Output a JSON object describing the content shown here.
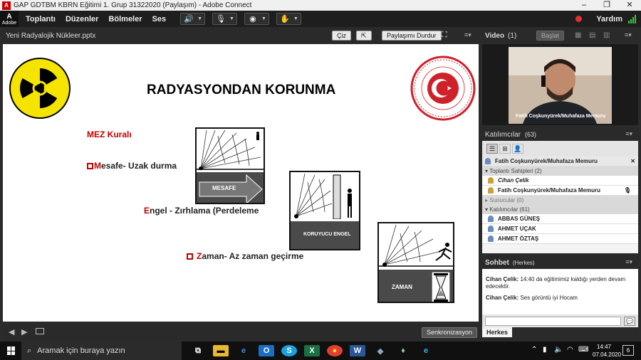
{
  "window": {
    "title": "GAP GDTBM KBRN Eğitimi 1. Grup 31322020 (Paylaşım) - Adobe Connect"
  },
  "menu": {
    "adobe_label": "Adobe",
    "items": [
      "Toplantı",
      "Düzenler",
      "Bölmeler",
      "Ses"
    ],
    "help": "Yardım"
  },
  "share": {
    "file_name": "Yeni Radyalojik Nükleer.pptx",
    "draw_label": "Çiz",
    "stop_label": "Paylaşımı Durdur",
    "sync_label": "Senkronizasyon"
  },
  "slide": {
    "title": "RADYASYONDAN KORUNMA",
    "rule_heading": "MEZ Kuralı",
    "item1_initial": "M",
    "item1_rest": "esafe- Uzak durma",
    "item2_initial": "E",
    "item2_rest": "ngel - Zırhlama (Perdeleme",
    "item3_initial": "Z",
    "item3_rest": "aman- Az zaman geçirme",
    "fig1_label": "MESAFE",
    "fig2_label": "KORUYUCU ENGEL",
    "fig3_label": "ZAMAN",
    "seal_text": "TÜRKİYE CUMHURİYETİ TİCARET BAKANLIĞI"
  },
  "video": {
    "title": "Video",
    "count": "(1)",
    "start_label": "Başlat",
    "caption": "Fatih Coşkunyürek/Muhafaza Memuru"
  },
  "participants": {
    "title": "Katılımcılar",
    "count": "(63)",
    "selected": "Fatih Coşkunyürek/Muhafaza Memuru",
    "hosts_header": "Toplantı Sahipleri (2)",
    "hosts": [
      "Cihan Çelik",
      "Fatih Coşkunyürek/Muhafaza Memuru"
    ],
    "presenters_header": "Sunucular (0)",
    "attendees_header": "Katılımcılar (61)",
    "attendees": [
      "ABBAS GÜNEŞ",
      "AHMET UÇAK",
      "AHMET ÖZTAŞ"
    ]
  },
  "chat": {
    "title": "Sohbet",
    "scope": "(Herkes)",
    "messages": [
      {
        "sender": "Cihan Çelik:",
        "text": "14:40 da eğitimimiz kaldığı yerden devam edecektir."
      },
      {
        "sender": "Cihan Çelik:",
        "text": "Ses görüntü iyi Hocam"
      }
    ],
    "tab": "Herkes"
  },
  "taskbar": {
    "search_placeholder": "Aramak için buraya yazın",
    "time": "14:47",
    "date": "07.04.2020",
    "notifications": "6"
  },
  "colors": {
    "accent_red": "#c00000",
    "dark_bar": "#1e1e1e"
  }
}
